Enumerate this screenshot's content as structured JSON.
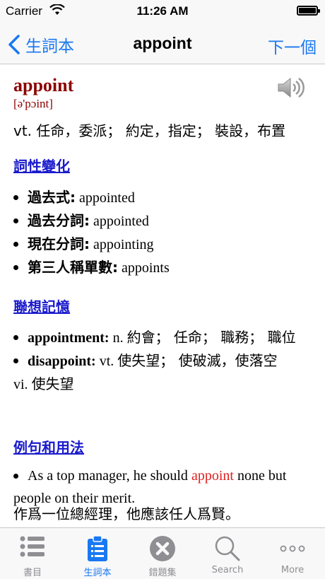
{
  "status": {
    "carrier": "Carrier",
    "time": "11:26 AM"
  },
  "nav": {
    "back": "生詞本",
    "title": "appoint",
    "next": "下一個"
  },
  "entry": {
    "word": "appoint",
    "phonetic": "[ə'pɔint]",
    "definition": "vt. 任命，委派； 約定，指定； 裝設，布置"
  },
  "sections": {
    "inflections": {
      "heading": "詞性變化",
      "items": [
        {
          "label": "過去式:",
          "value": "appointed"
        },
        {
          "label": "過去分詞:",
          "value": "appointed"
        },
        {
          "label": "現在分詞:",
          "value": "appointing"
        },
        {
          "label": "第三人稱單數:",
          "value": "appoints"
        }
      ]
    },
    "associations": {
      "heading": "聯想記憶",
      "items": [
        {
          "word": "appointment:",
          "pos": "n.",
          "meaning": "約會； 任命； 職務； 職位"
        },
        {
          "word": "disappoint:",
          "pos": "vt.",
          "meaning": "使失望； 使破滅，使落空",
          "extra_pos": "vi.",
          "extra_meaning": "使失望"
        }
      ]
    },
    "examples": {
      "heading": "例句和用法",
      "items": [
        {
          "before": "As a top manager, he should ",
          "highlight": "appoint",
          "after": " none but people on their merit.",
          "translation": "作爲一位總經理，他應該任人爲賢。"
        }
      ]
    }
  },
  "tabs": [
    {
      "label": "書目",
      "icon": "list-icon"
    },
    {
      "label": "生詞本",
      "icon": "clipboard-icon",
      "active": true
    },
    {
      "label": "錯題集",
      "icon": "close-circle-icon"
    },
    {
      "label": "Search",
      "icon": "search-icon"
    },
    {
      "label": "More",
      "icon": "more-icon"
    }
  ],
  "colors": {
    "accent": "#1a78f2",
    "word": "#8b0000",
    "link": "#1a1acd",
    "highlight": "#e02020"
  }
}
